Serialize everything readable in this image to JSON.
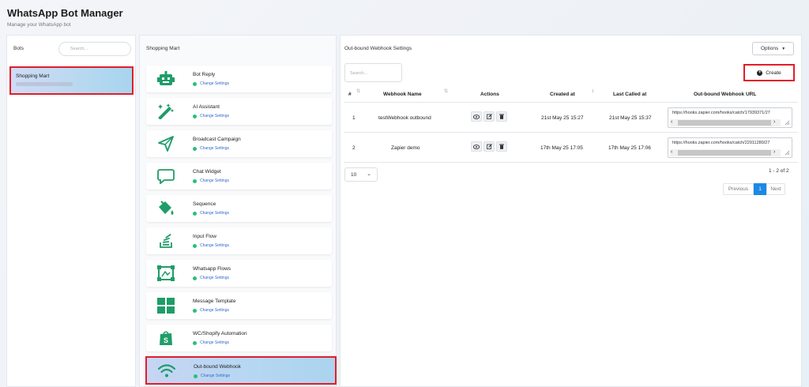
{
  "header": {
    "title": "WhatsApp Bot Manager",
    "subtitle": "Manage your WhatsApp bot"
  },
  "bots_panel": {
    "label": "Bots",
    "search_placeholder": "Search...",
    "items": [
      {
        "name": "Shopping Mart"
      }
    ]
  },
  "modules_panel": {
    "title": "Shopping Mart",
    "change_label": "Change Settings",
    "items": [
      {
        "title": "Bot Reply",
        "icon": "robot-icon"
      },
      {
        "title": "AI Assistant",
        "icon": "magic-wand-icon"
      },
      {
        "title": "Broadcast Campaign",
        "icon": "paper-plane-icon"
      },
      {
        "title": "Chat Widget",
        "icon": "chat-bubble-icon"
      },
      {
        "title": "Sequence",
        "icon": "paint-bucket-icon"
      },
      {
        "title": "Input Flow",
        "icon": "stack-icon"
      },
      {
        "title": "Whatsapp Flows",
        "icon": "flow-icon"
      },
      {
        "title": "Message Template",
        "icon": "grid-icon"
      },
      {
        "title": "WC/Shopify Automation",
        "icon": "shopify-bag-icon"
      },
      {
        "title": "Out-bound Webhook",
        "icon": "wifi-icon",
        "active": true
      }
    ]
  },
  "webhook_panel": {
    "title": "Out-bound Webhook Settings",
    "options_label": "Options",
    "create_label": "Create",
    "search_placeholder": "Search...",
    "columns": [
      "#",
      "Webhook Name",
      "Actions",
      "Created at",
      "Last Called at",
      "Out-bound Webhook URL"
    ],
    "rows": [
      {
        "num": "1",
        "name": "testWebhook outbound",
        "created": "21st May 25 15:27",
        "last_called": "21st May 25 15:37",
        "url": "https://hooks.zapier.com/hooks/catch/17939371/27"
      },
      {
        "num": "2",
        "name": "Zapier demo",
        "created": "17th May 25 17:05",
        "last_called": "17th May 25 17:06",
        "url": "https://hooks.zapier.com/hooks/catch/22911280/27"
      }
    ],
    "per_page": "10",
    "count_text": "1 - 2 of 2",
    "pagination": {
      "prev": "Previous",
      "current": "1",
      "next": "Next"
    }
  },
  "colors": {
    "highlight_border": "#e11d2a",
    "accent_green": "#1f9d68",
    "status_dot": "#28c07a",
    "pager_active": "#1e88e5"
  }
}
